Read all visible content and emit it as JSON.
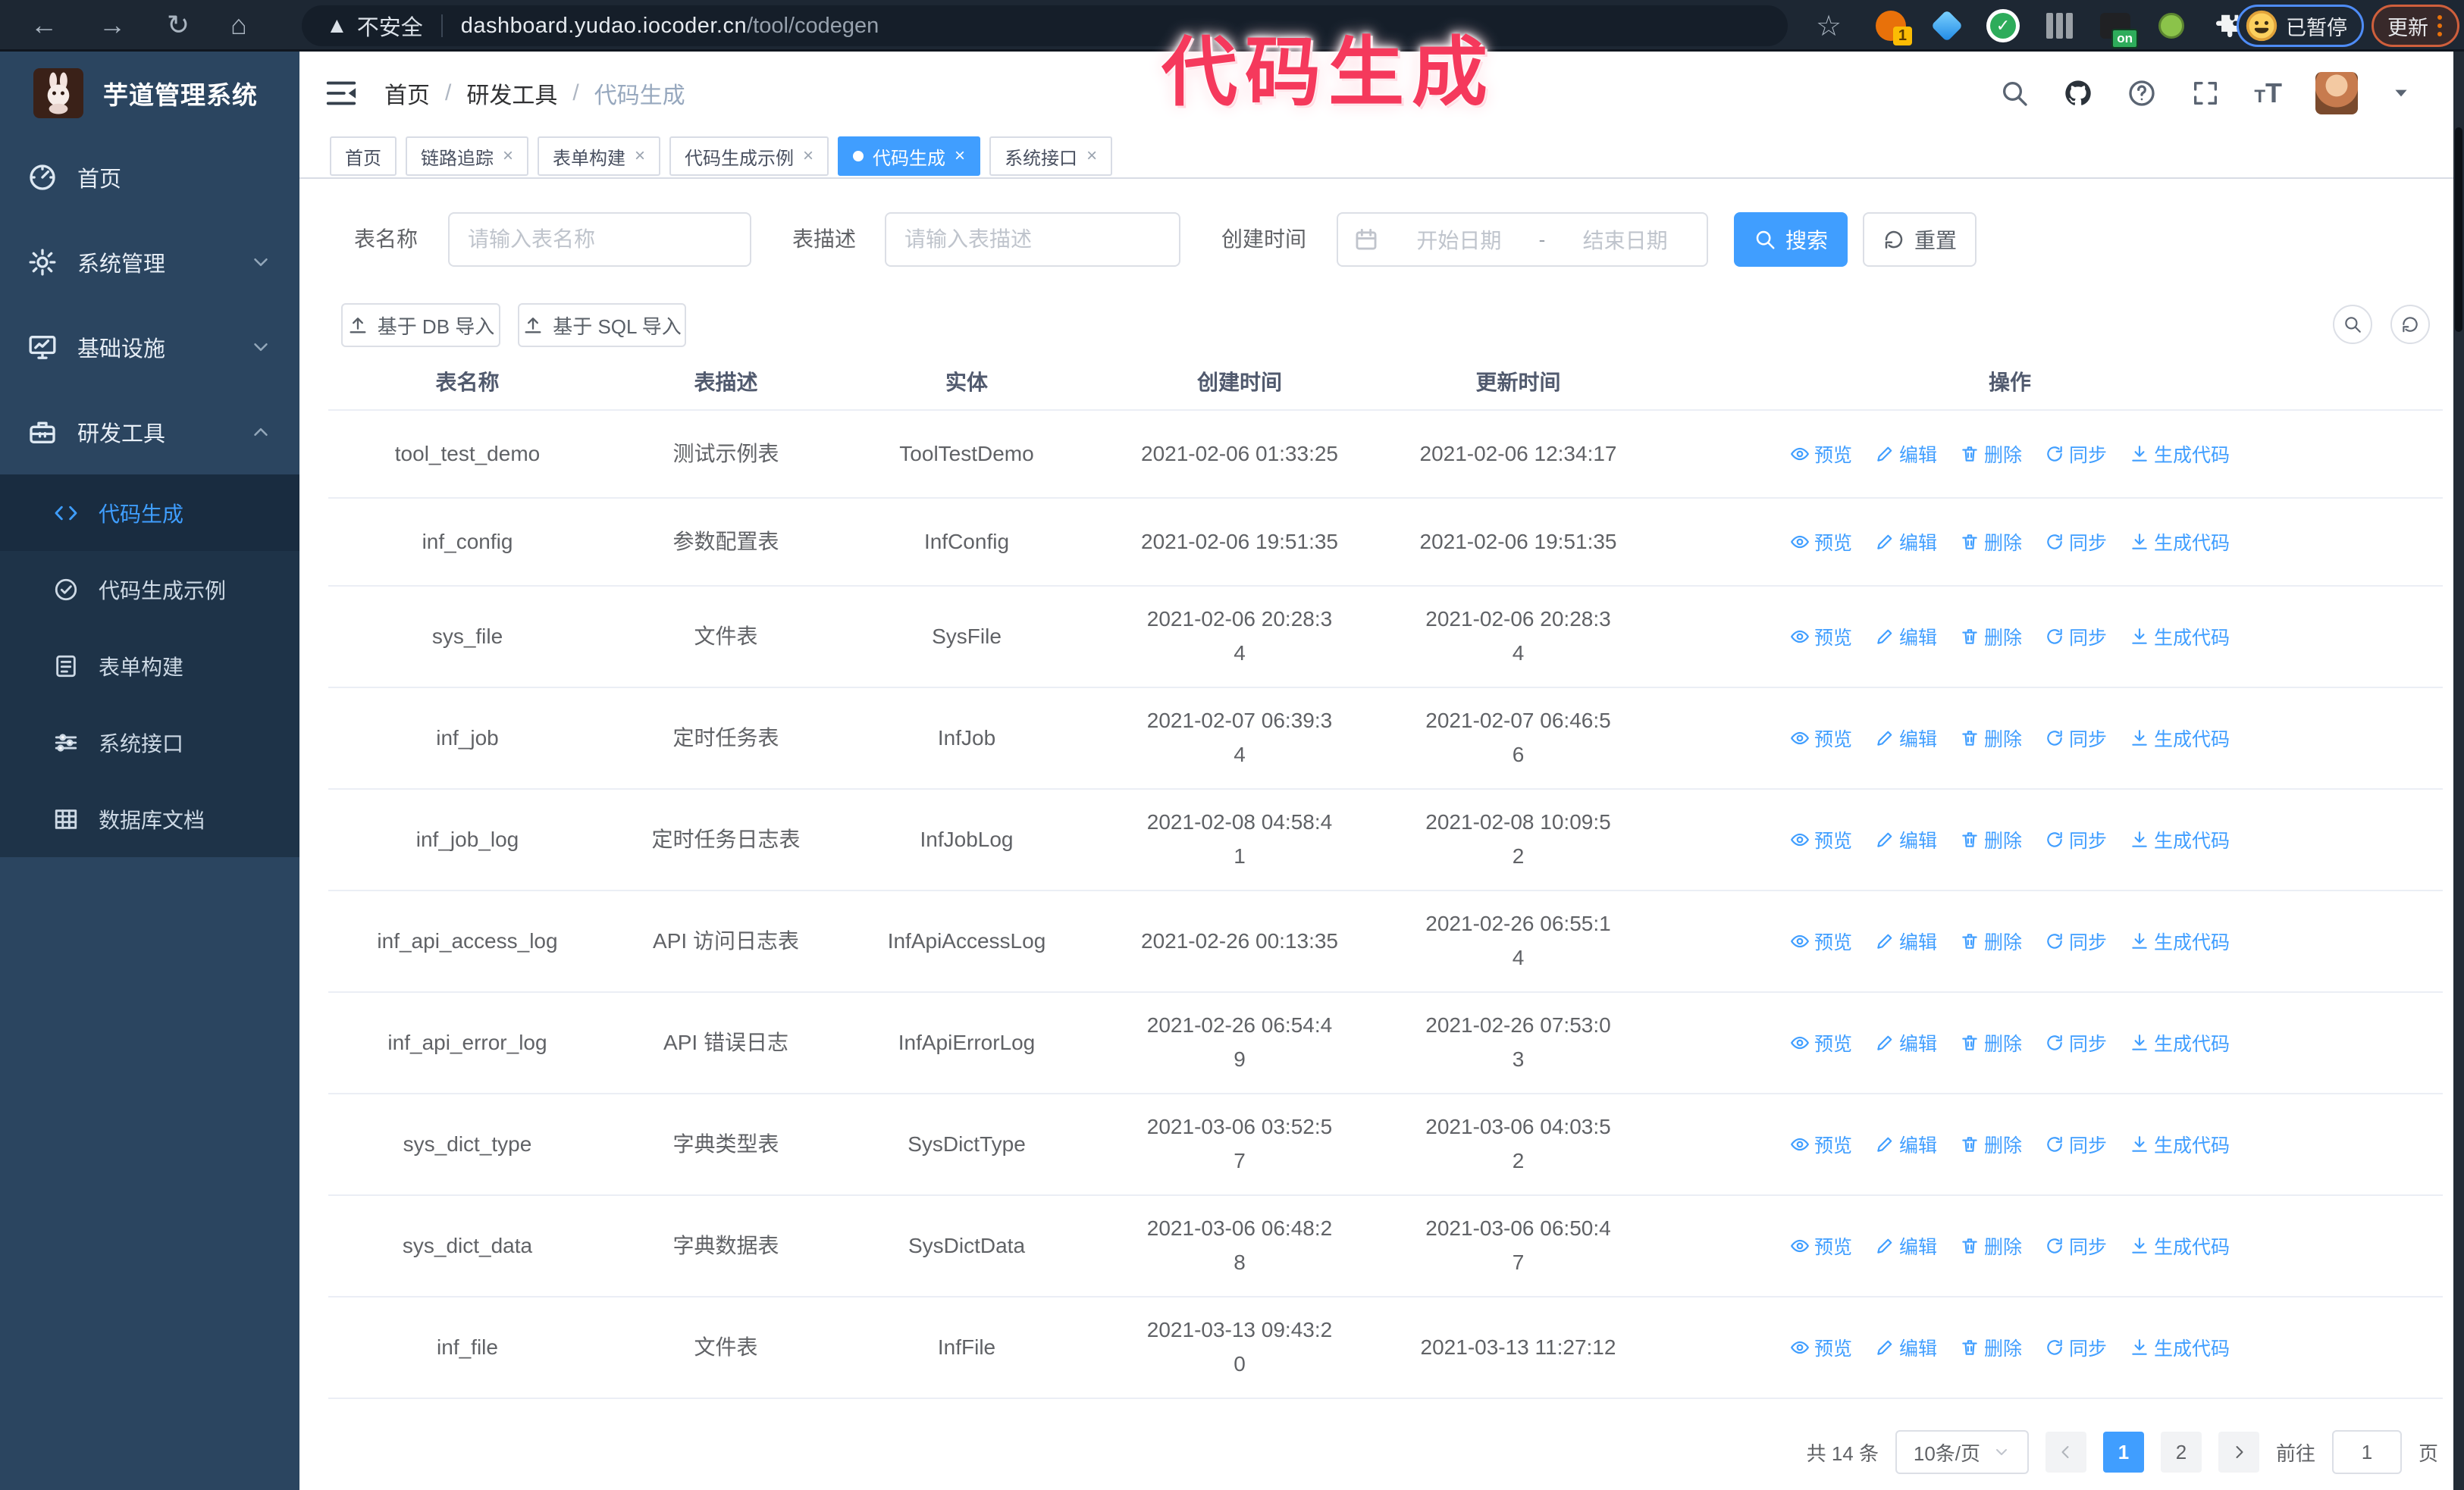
{
  "browser": {
    "security_label": "不安全",
    "url_domain": "dashboard.yudao.iocoder.cn",
    "url_path": "/tool/codegen",
    "extension_badge": "1",
    "extension_on_badge": "on",
    "profile_badge": "已暂停",
    "update_button": "更新"
  },
  "watermark": "代码生成",
  "sidebar": {
    "title": "芋道管理系统",
    "items": [
      {
        "label": "首页",
        "expandable": false
      },
      {
        "label": "系统管理",
        "expandable": true
      },
      {
        "label": "基础设施",
        "expandable": true
      },
      {
        "label": "研发工具",
        "expandable": true,
        "expanded": true
      }
    ],
    "subitems": [
      {
        "label": "代码生成",
        "active": true
      },
      {
        "label": "代码生成示例",
        "active": false
      },
      {
        "label": "表单构建",
        "active": false
      },
      {
        "label": "系统接口",
        "active": false
      },
      {
        "label": "数据库文档",
        "active": false
      }
    ]
  },
  "header": {
    "breadcrumb": {
      "0": "首页",
      "1": "研发工具",
      "2": "代码生成",
      "separator": "/"
    }
  },
  "tabs": [
    {
      "label": "首页"
    },
    {
      "label": "链路追踪"
    },
    {
      "label": "表单构建"
    },
    {
      "label": "代码生成示例"
    },
    {
      "label": "代码生成",
      "active": true
    },
    {
      "label": "系统接口"
    }
  ],
  "tab_close_glyph": "×",
  "filters": {
    "table_name_label": "表名称",
    "table_name_placeholder": "请输入表名称",
    "table_desc_label": "表描述",
    "table_desc_placeholder": "请输入表描述",
    "create_time_label": "创建时间",
    "start_date_placeholder": "开始日期",
    "date_separator": "-",
    "end_date_placeholder": "结束日期",
    "search_label": "搜索",
    "reset_label": "重置"
  },
  "toolbar": {
    "import_db_label": "基于 DB 导入",
    "import_sql_label": "基于 SQL 导入"
  },
  "table": {
    "columns": {
      "name": "表名称",
      "desc": "表描述",
      "entity": "实体",
      "created": "创建时间",
      "updated": "更新时间",
      "actions": "操作"
    },
    "action_labels": {
      "preview": "预览",
      "edit": "编辑",
      "delete": "删除",
      "sync": "同步",
      "generate": "生成代码"
    },
    "rows": [
      {
        "name": "tool_test_demo",
        "desc": "测试示例表",
        "entity": "ToolTestDemo",
        "created": "2021-02-06 01:33:25",
        "updated": "2021-02-06 12:34:17"
      },
      {
        "name": "inf_config",
        "desc": "参数配置表",
        "entity": "InfConfig",
        "created": "2021-02-06 19:51:35",
        "updated": "2021-02-06 19:51:35"
      },
      {
        "name": "sys_file",
        "desc": "文件表",
        "entity": "SysFile",
        "created": "2021-02-06 20:28:3\n4",
        "updated": "2021-02-06 20:28:3\n4"
      },
      {
        "name": "inf_job",
        "desc": "定时任务表",
        "entity": "InfJob",
        "created": "2021-02-07 06:39:3\n4",
        "updated": "2021-02-07 06:46:5\n6"
      },
      {
        "name": "inf_job_log",
        "desc": "定时任务日志表",
        "entity": "InfJobLog",
        "created": "2021-02-08 04:58:4\n1",
        "updated": "2021-02-08 10:09:5\n2"
      },
      {
        "name": "inf_api_access_log",
        "desc": "API 访问日志表",
        "entity": "InfApiAccessLog",
        "created": "2021-02-26 00:13:35",
        "updated": "2021-02-26 06:55:1\n4"
      },
      {
        "name": "inf_api_error_log",
        "desc": "API 错误日志",
        "entity": "InfApiErrorLog",
        "created": "2021-02-26 06:54:4\n9",
        "updated": "2021-02-26 07:53:0\n3"
      },
      {
        "name": "sys_dict_type",
        "desc": "字典类型表",
        "entity": "SysDictType",
        "created": "2021-03-06 03:52:5\n7",
        "updated": "2021-03-06 04:03:5\n2"
      },
      {
        "name": "sys_dict_data",
        "desc": "字典数据表",
        "entity": "SysDictData",
        "created": "2021-03-06 06:48:2\n8",
        "updated": "2021-03-06 06:50:4\n7"
      },
      {
        "name": "inf_file",
        "desc": "文件表",
        "entity": "InfFile",
        "created": "2021-03-13 09:43:2\n0",
        "updated": "2021-03-13 11:27:12"
      }
    ]
  },
  "pagination": {
    "total_text": "共 14 条",
    "page_size": "10条/页",
    "page_1": "1",
    "page_2": "2",
    "active_page": "1",
    "goto_label": "前往",
    "goto_value": "1",
    "goto_suffix": "页"
  },
  "colors": {
    "accent": "#409eff",
    "sidebar_bg": "#2b4560",
    "submenu_bg": "#1e3348",
    "watermark": "#f5395c",
    "tab_active": "#409eff"
  }
}
